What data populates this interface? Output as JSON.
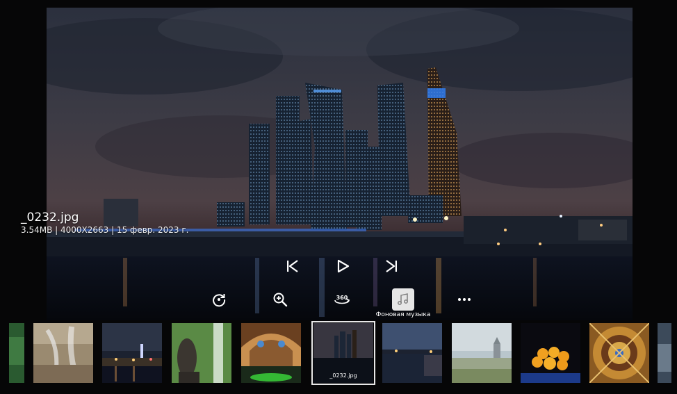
{
  "file": {
    "name": "_0232.jpg",
    "size": "3.54MB",
    "resolution": "4000X2663",
    "date": "15 февр. 2023 г."
  },
  "playback": {
    "previous_icon": "skip-previous-icon",
    "play_icon": "play-icon",
    "next_icon": "skip-next-icon"
  },
  "tools": {
    "rotate_icon": "rotate-icon",
    "zoom_icon": "zoom-in-icon",
    "view360_icon": "360-view-icon",
    "view360_text": "360",
    "music_icon": "music-note-icon",
    "music_label": "Фоновая музыка",
    "more_icon": "more-icon"
  },
  "filmstrip": {
    "selected_caption": "_0232.jpg",
    "items": [
      {
        "name": "partial-left"
      },
      {
        "name": "fountain"
      },
      {
        "name": "night-city"
      },
      {
        "name": "statue-park"
      },
      {
        "name": "arch-mosaic"
      },
      {
        "name": "moscow-city-night",
        "selected": true
      },
      {
        "name": "river-dusk"
      },
      {
        "name": "foggy-church"
      },
      {
        "name": "oranges"
      },
      {
        "name": "ornate-dome"
      },
      {
        "name": "partial-right"
      }
    ]
  },
  "colors": {
    "background": "#060607",
    "selected_tool": "#e6e6e6",
    "icon": "#ffffff"
  }
}
